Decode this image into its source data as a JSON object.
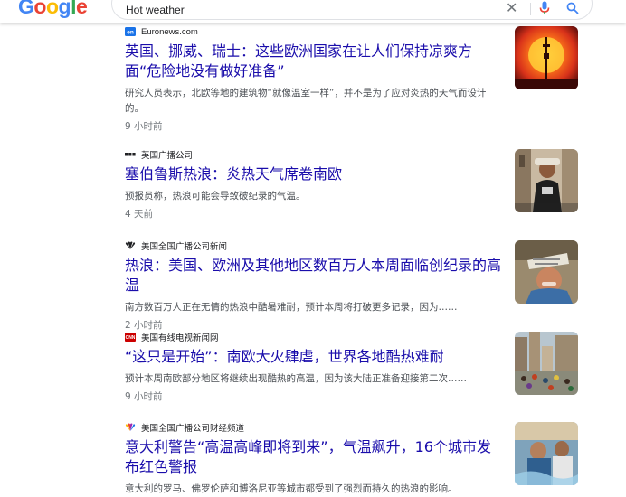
{
  "search": {
    "logo_letters": [
      {
        "ch": "G",
        "color": "#4285f4"
      },
      {
        "ch": "o",
        "color": "#ea4335"
      },
      {
        "ch": "o",
        "color": "#fbbc05"
      },
      {
        "ch": "g",
        "color": "#4285f4"
      },
      {
        "ch": "l",
        "color": "#34a853"
      },
      {
        "ch": "e",
        "color": "#ea4335"
      }
    ],
    "query": "Hot weather",
    "clear_icon": "close-icon",
    "mic_icon": "microphone-icon",
    "search_icon": "search-icon"
  },
  "results": [
    {
      "source": "Euronews.com",
      "title": "英国、挪威、瑞士：这些欧洲国家在让人们保持凉爽方面“危险地没有做好准备”",
      "snippet": "研究人员表示，北欧等地的建筑物“就像温室一样”，并不是为了应对炎热的天气而设计的。",
      "time": "9 小时前",
      "favicon": "euronews-favicon"
    },
    {
      "source": "英国广播公司",
      "title": "塞伯鲁斯热浪：炎热天气席卷南欧",
      "snippet": "预报员称，热浪可能会导致破纪录的气温。",
      "time": "4 天前",
      "favicon": "bbc-favicon"
    },
    {
      "source": "美国全国广播公司新闻",
      "title": "热浪：美国、欧洲及其他地区数百万人本周面临创纪录的高温",
      "snippet": "南方数百万人正在无情的热浪中酷暑难耐，预计本周将打破更多记录，因为……",
      "time": "2 小时前",
      "favicon": "nbc-favicon"
    },
    {
      "source": "美国有线电视新闻网",
      "title": "“这只是开始”：南欧大火肆虐，世界各地酷热难耐",
      "snippet": "预计本周南欧部分地区将继续出现酷热的高温，因为该大陆正准备迎接第二次……",
      "time": "9 小时前",
      "favicon": "cnn-favicon"
    },
    {
      "source": "美国全国广播公司财经频道",
      "title": "意大利警告“高温高峰即将到来”，气温飙升，16个城市发布红色警报",
      "snippet": "意大利的罗马、佛罗伦萨和博洛尼亚等城市都受到了强烈而持久的热浪的影响。",
      "time": "",
      "favicon": "cnbc-favicon"
    }
  ]
}
